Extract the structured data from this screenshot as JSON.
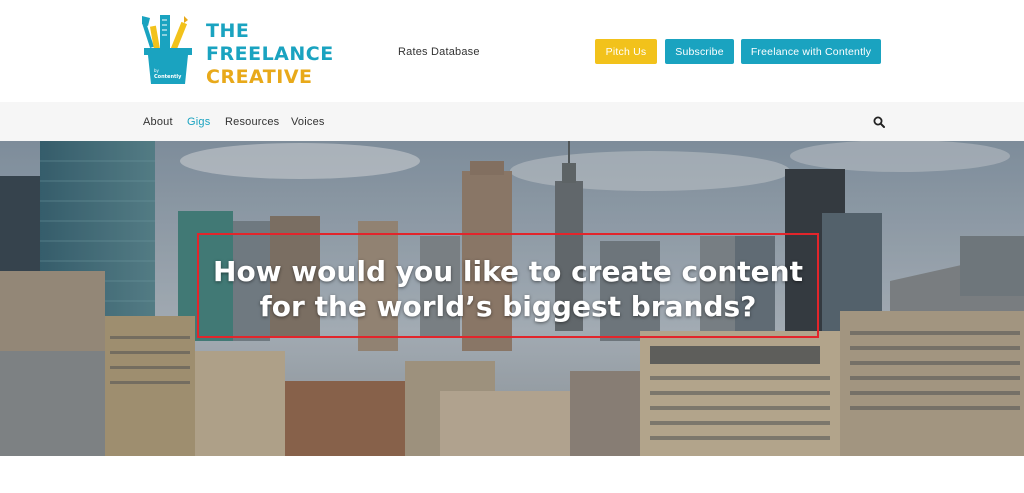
{
  "colors": {
    "teal": "#1aa3c0",
    "yellow": "#f2c21b",
    "gold": "#e8a91a",
    "nav_bg": "#f6f6f6",
    "hero_border": "#e2252b",
    "active_nav": "#1aa3c0"
  },
  "logo": {
    "line1": "THE",
    "line2": "FREELANCE",
    "line3": "CREATIVE",
    "badge": "by Contently",
    "icon": "pencil-cup-logo-icon"
  },
  "header": {
    "rates_link": "Rates Database",
    "buttons": {
      "pitch": "Pitch Us",
      "subscribe": "Subscribe",
      "freelance": "Freelance with Contently"
    }
  },
  "nav": {
    "items": [
      {
        "label": "About",
        "active": false
      },
      {
        "label": "Gigs",
        "active": true
      },
      {
        "label": "Resources",
        "active": false
      },
      {
        "label": "Voices",
        "active": false
      }
    ],
    "search_icon": "search-icon"
  },
  "hero": {
    "line1": "How would you like to create content",
    "line2": "for the world’s biggest brands?",
    "image": "new-york-skyline-photo"
  }
}
